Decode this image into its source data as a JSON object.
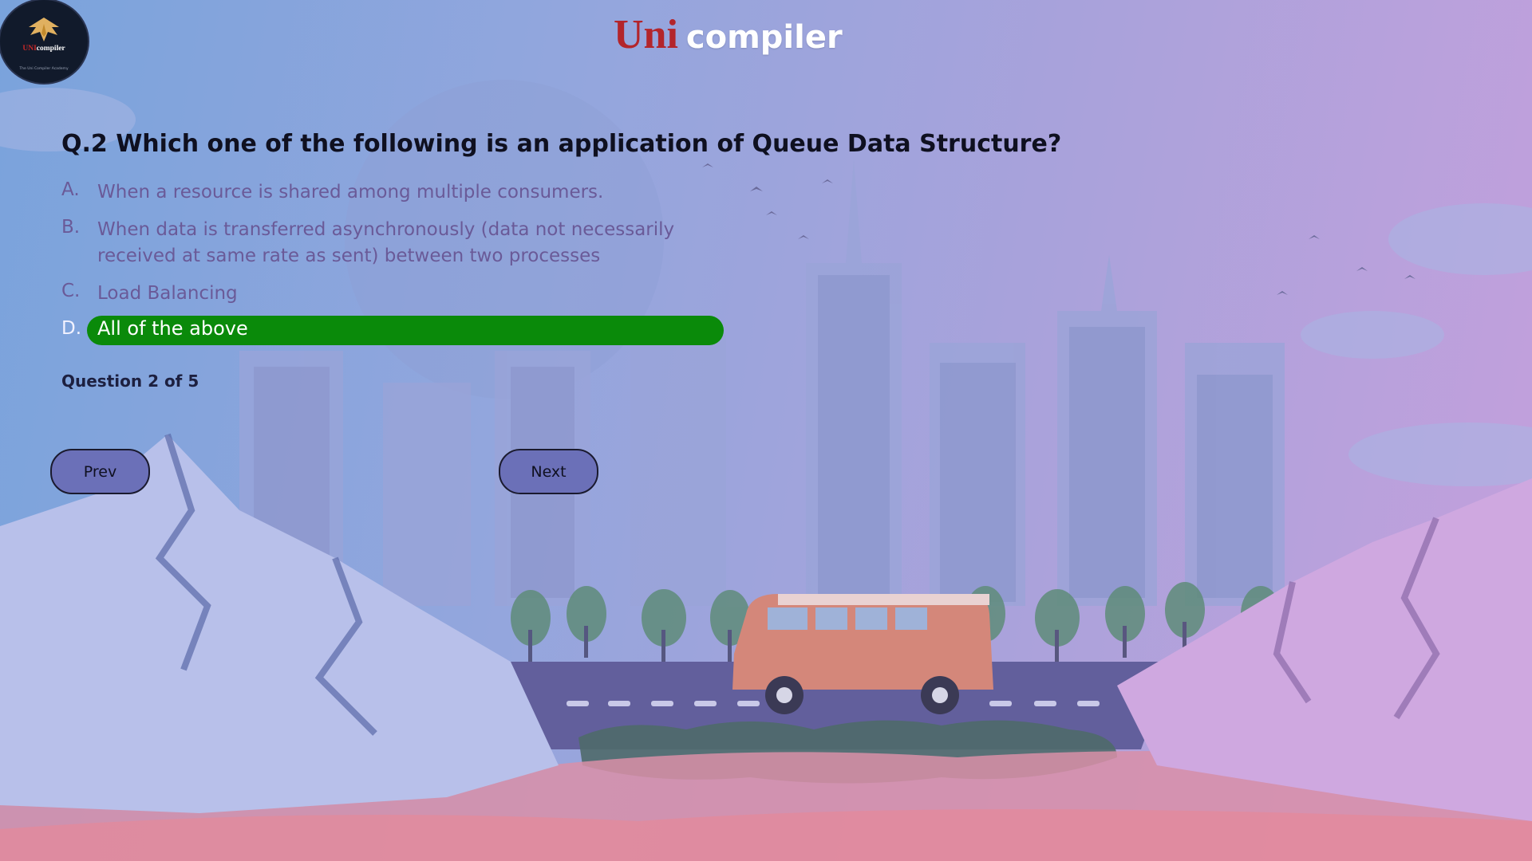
{
  "logo": {
    "name_prefix": "UNI",
    "name_suffix": "compiler",
    "tagline": "The Uni Compiler Academy"
  },
  "brand": {
    "uni": "Uni",
    "compiler": "compiler"
  },
  "quiz": {
    "question": "Q.2 Which one of the following is an application of Queue Data Structure?",
    "options": [
      {
        "letter": "A.",
        "text": "When a resource is shared among multiple consumers."
      },
      {
        "letter": "B.",
        "text_line1": "When data is transferred asynchronously (data not necessarily",
        "text_line2": "received at same rate as sent) between two processes"
      },
      {
        "letter": "C.",
        "text": "Load Balancing"
      },
      {
        "letter": "D.",
        "text": "All of the above",
        "selected": true
      }
    ],
    "selected_color": "#0a8a0a",
    "progress": "Question 2 of 5"
  },
  "buttons": {
    "prev": "Prev",
    "next": "Next"
  },
  "colors": {
    "brand_red": "#b3252b",
    "button_fill": "#6b70b8",
    "option_text": "#6a5a98"
  }
}
